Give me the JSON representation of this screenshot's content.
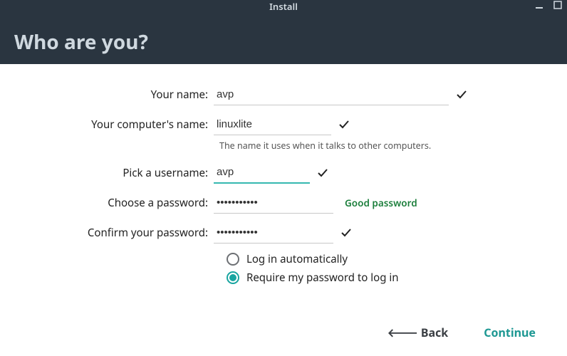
{
  "window": {
    "title": "Install"
  },
  "heading": "Who are you?",
  "form": {
    "name_label": "Your name:",
    "name_value": "avp",
    "computer_label": "Your computer's name:",
    "computer_value": "linuxlite",
    "computer_helper": "The name it uses when it talks to other computers.",
    "username_label": "Pick a username:",
    "username_value": "avp",
    "password_label": "Choose a password:",
    "password_value": "•••••••••••",
    "password_strength": "Good password",
    "confirm_label": "Confirm your password:",
    "confirm_value": "•••••••••••",
    "login_auto": "Log in automatically",
    "login_require": "Require my password to log in"
  },
  "footer": {
    "back": "Back",
    "continue": "Continue"
  }
}
